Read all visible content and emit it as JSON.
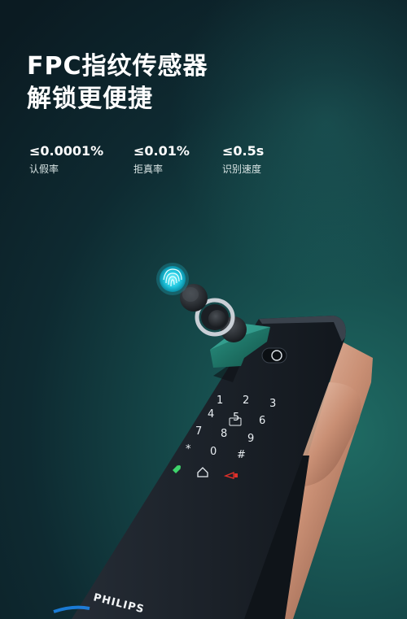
{
  "headline": {
    "line1": "FPC指纹传感器",
    "line2": "解锁更便捷"
  },
  "specs": [
    {
      "value": "≤0.0001%",
      "label": "认假率"
    },
    {
      "value": "≤0.01%",
      "label": "拒真率"
    },
    {
      "value": "≤0.5s",
      "label": "识别速度"
    }
  ],
  "keypad": [
    "1",
    "2",
    "3",
    "4",
    "5",
    "6",
    "7",
    "8",
    "9",
    "*",
    "0",
    "#"
  ],
  "brand": "PHILIPS",
  "colors": {
    "background": "#0e2a31",
    "lock_body": "#1a2028",
    "fingerprint_glow": "#33e0f0",
    "module_green": "#1f7a6e",
    "handle_rose": "#d9a68c",
    "accent_red": "#e0302a",
    "accent_green": "#3fd36b"
  },
  "icons": [
    "fingerprint-icon",
    "unlock-icon",
    "home-icon",
    "doorbell-icon"
  ]
}
